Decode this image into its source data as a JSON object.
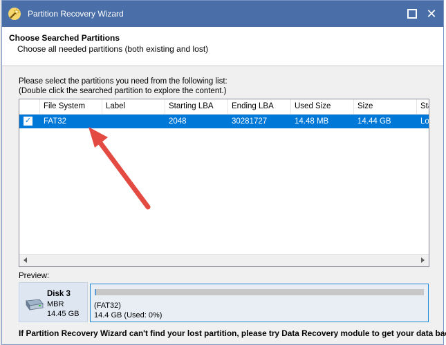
{
  "window": {
    "title": "Partition Recovery Wizard"
  },
  "header": {
    "title": "Choose Searched Partitions",
    "subtitle": "Choose all needed partitions (both existing and lost)"
  },
  "instructions": {
    "line1": "Please select the partitions you need from the following list:",
    "line2": "(Double click the searched partition to explore the content.)"
  },
  "table": {
    "columns": [
      "",
      "File System",
      "Label",
      "Starting LBA",
      "Ending LBA",
      "Used Size",
      "Size",
      "Stat"
    ],
    "rows": [
      {
        "checked": true,
        "file_system": "FAT32",
        "label": "",
        "starting_lba": "2048",
        "ending_lba": "30281727",
        "used_size": "14.48 MB",
        "size": "14.44 GB",
        "status": "Los"
      }
    ]
  },
  "preview": {
    "label": "Preview:",
    "disk": {
      "name": "Disk 3",
      "type": "MBR",
      "size": "14.45 GB"
    },
    "partition": {
      "fs": "(FAT32)",
      "info": "14.4 GB (Used: 0%)",
      "used_fraction": 0.002
    }
  },
  "footer_note": "If Partition Recovery Wizard can't find your lost partition, please try Data Recovery module to get your data back.",
  "colors": {
    "titlebar": "#4a6ea8",
    "selection": "#0078d7",
    "annotation_arrow": "#e34b42"
  },
  "icons": {
    "app": "wizard-wand-icon",
    "disk": "disk-drive-icon",
    "checkbox": "checkmark-icon"
  }
}
